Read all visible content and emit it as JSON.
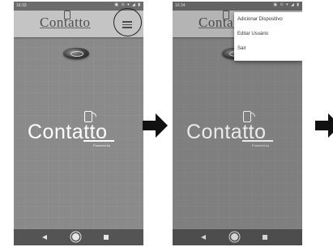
{
  "screens": [
    {
      "status_time": "16:33",
      "status_icons": "▣ ⊙ ▾ ◢ ▮",
      "appbar_logo": "Contatto",
      "big_logo": "Contatto",
      "powered_by": "Powered by"
    },
    {
      "status_time": "16:34",
      "status_icons": "▣ ⊙ ▾ ◢ ▮",
      "appbar_logo": "Contatto",
      "big_logo": "Contatto",
      "powered_by": "Powered by",
      "menu": [
        "Adicionar Dispositivo",
        "Editar Usuário",
        "Sair"
      ]
    }
  ],
  "navbar_icons": [
    "back-icon",
    "home-icon",
    "recent-apps-icon"
  ],
  "flow_arrows": [
    "arrow-right-icon",
    "arrow-right-icon"
  ]
}
